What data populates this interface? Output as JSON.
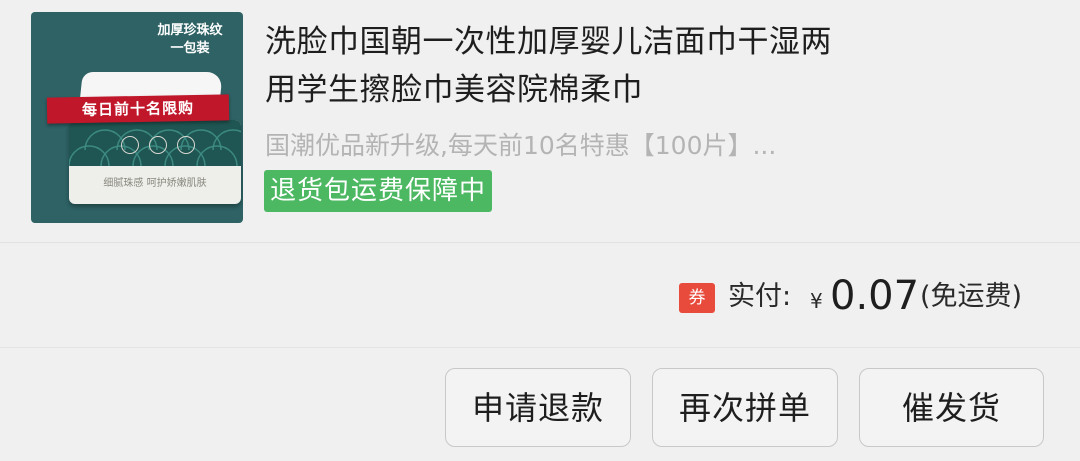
{
  "product": {
    "image": {
      "caption_line1": "加厚珍珠纹",
      "caption_line2": "一包装",
      "banner": "每日前十名限购",
      "pack_text": "细腻珠感 呵护娇嫩肌肤"
    },
    "title_line1": "洗脸巾国朝一次性加厚婴儿洁面巾干湿两",
    "title_line2": "用学生擦脸巾美容院棉柔巾",
    "subtitle": "国潮优品新升级,每天前10名特惠【100片】...",
    "guarantee_tag": "退货包运费保障中"
  },
  "payment": {
    "coupon_badge": "券",
    "label": "实付:",
    "currency": "¥",
    "amount": "0.07",
    "shipping_note": "(免运费)"
  },
  "actions": {
    "refund": "申请退款",
    "reorder": "再次拼单",
    "urge_shipping": "催发货"
  },
  "colors": {
    "guarantee_green": "#4cb862",
    "coupon_red": "#e84a3c",
    "thumb_teal": "#2e6265",
    "banner_red": "#c0172a"
  }
}
